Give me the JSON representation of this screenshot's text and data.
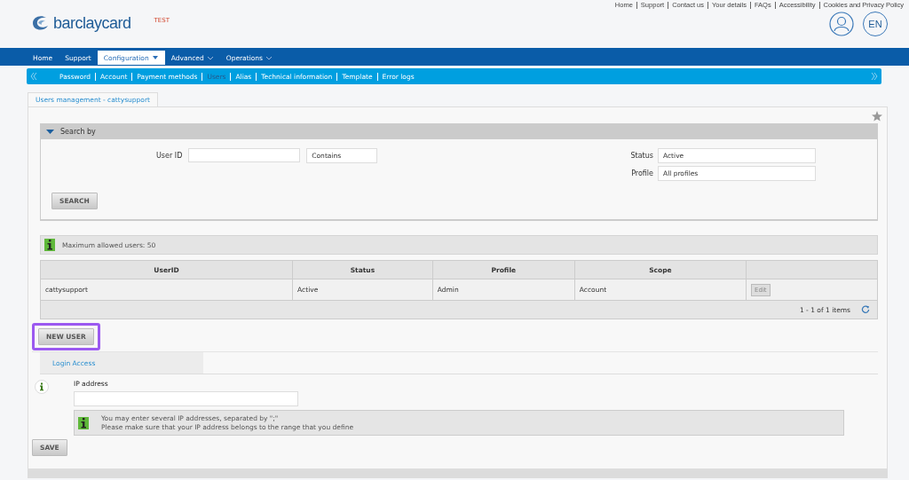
{
  "header": {
    "logo": "barclaycard",
    "environment": "TEST",
    "top_links": [
      "Home",
      "Support",
      "Contact us",
      "Your details",
      "FAQs",
      "Accessibility",
      "Cookies and Privacy Policy"
    ],
    "language": "EN"
  },
  "main_nav": [
    {
      "label": "Home",
      "selected": false,
      "dropdown": false
    },
    {
      "label": "Support",
      "selected": false,
      "dropdown": false
    },
    {
      "label": "Configuration",
      "selected": true,
      "dropdown": true
    },
    {
      "label": "Advanced",
      "selected": false,
      "dropdown": true
    },
    {
      "label": "Operations",
      "selected": false,
      "dropdown": true
    }
  ],
  "sub_nav": [
    {
      "label": "Password",
      "selected": false
    },
    {
      "label": "Account",
      "selected": false
    },
    {
      "label": "Payment methods",
      "selected": false
    },
    {
      "label": "Users",
      "selected": true
    },
    {
      "label": "Alias",
      "selected": false
    },
    {
      "label": "Technical information",
      "selected": false
    },
    {
      "label": "Template",
      "selected": false
    },
    {
      "label": "Error logs",
      "selected": false
    }
  ],
  "page_tab": "Users management - cattysupport",
  "search": {
    "title": "Search by",
    "expanded": true,
    "user_id_label": "User ID",
    "match": "Contains",
    "status_label": "Status",
    "status": "Active",
    "profile_label": "Profile",
    "profile": "All profiles",
    "button": "SEARCH"
  },
  "info": "Maximum allowed users: 50",
  "table": {
    "columns": [
      "UserID",
      "Status",
      "Profile",
      "Scope"
    ],
    "rows": [
      {
        "cells": [
          "cattysupport",
          "Active",
          "Admin",
          "Account"
        ],
        "action": "Edit"
      }
    ],
    "pager": "1 - 1 of 1 items"
  },
  "new_user": {
    "label": "NEW USER",
    "highlighted": true
  },
  "login_access": {
    "tab": "Login Access",
    "field_label": "IP address",
    "hint": [
      "You may enter several IP addresses, separated by \";\"",
      "Please make sure that your IP address belongs to the range that you define"
    ],
    "button": "SAVE"
  }
}
